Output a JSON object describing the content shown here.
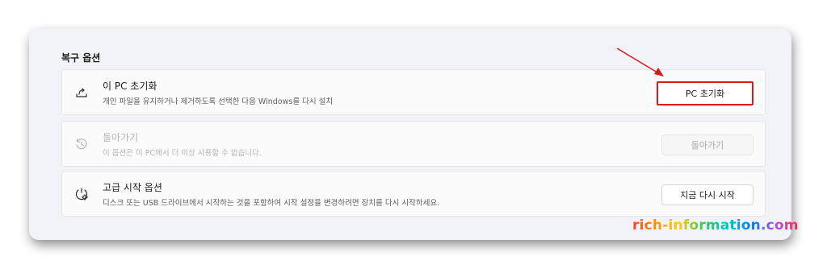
{
  "section": {
    "title": "복구 옵션"
  },
  "options": [
    {
      "title": "이 PC 초기화",
      "description": "개인 파일을 유지하거나 제거하도록 선택한 다음 Windows를 다시 설치",
      "button": "PC 초기화",
      "icon": "reset-pc-icon",
      "enabled": true,
      "highlighted": true
    },
    {
      "title": "돌아가기",
      "description": "이 옵션은 이 PC에서 더 이상 사용할 수 없습니다.",
      "button": "돌아가기",
      "icon": "history-icon",
      "enabled": false,
      "highlighted": false
    },
    {
      "title": "고급 시작 옵션",
      "description": "디스크 또는 USB 드라이브에서 시작하는 것을 포함하여 시작 설정을 변경하려면 장치를 다시 시작하세요.",
      "button": "지금 다시 시작",
      "icon": "advanced-startup-icon",
      "enabled": true,
      "highlighted": false
    }
  ],
  "watermark": "rich-information.com",
  "colors": {
    "highlight": "#d91a1a",
    "panel_bg": "#f1f3f8",
    "card_bg": "#fbfbfb"
  }
}
